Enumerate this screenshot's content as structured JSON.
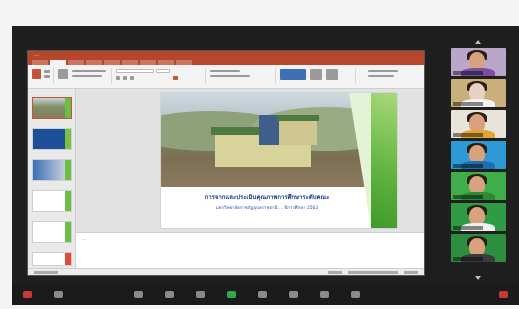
{
  "window": {
    "title": "…"
  },
  "slide": {
    "title": "การจากและประเมินคุณภาพการศึกษาระดับคณะ",
    "subtitle": "มหาวิทยาลัยราชภัฏอุบลราชธานี ... ปีการศึกษา 2563"
  },
  "notes": {
    "placeholder": "…"
  },
  "participants": [
    {
      "name": ""
    },
    {
      "name": ""
    },
    {
      "name": ""
    },
    {
      "name": ""
    },
    {
      "name": ""
    },
    {
      "name": ""
    },
    {
      "name": ""
    }
  ],
  "colors": {
    "ppt_accent": "#b7472a",
    "slide_green": "#5fb23d",
    "slide_title_blue": "#1e3f8f",
    "meeting_background": "#1f1f1f"
  },
  "icons": [
    "minimize-icon",
    "maximize-icon",
    "close-icon",
    "mute-icon",
    "video-icon",
    "share-screen-icon",
    "participants-icon",
    "chat-icon",
    "end-call-icon"
  ]
}
